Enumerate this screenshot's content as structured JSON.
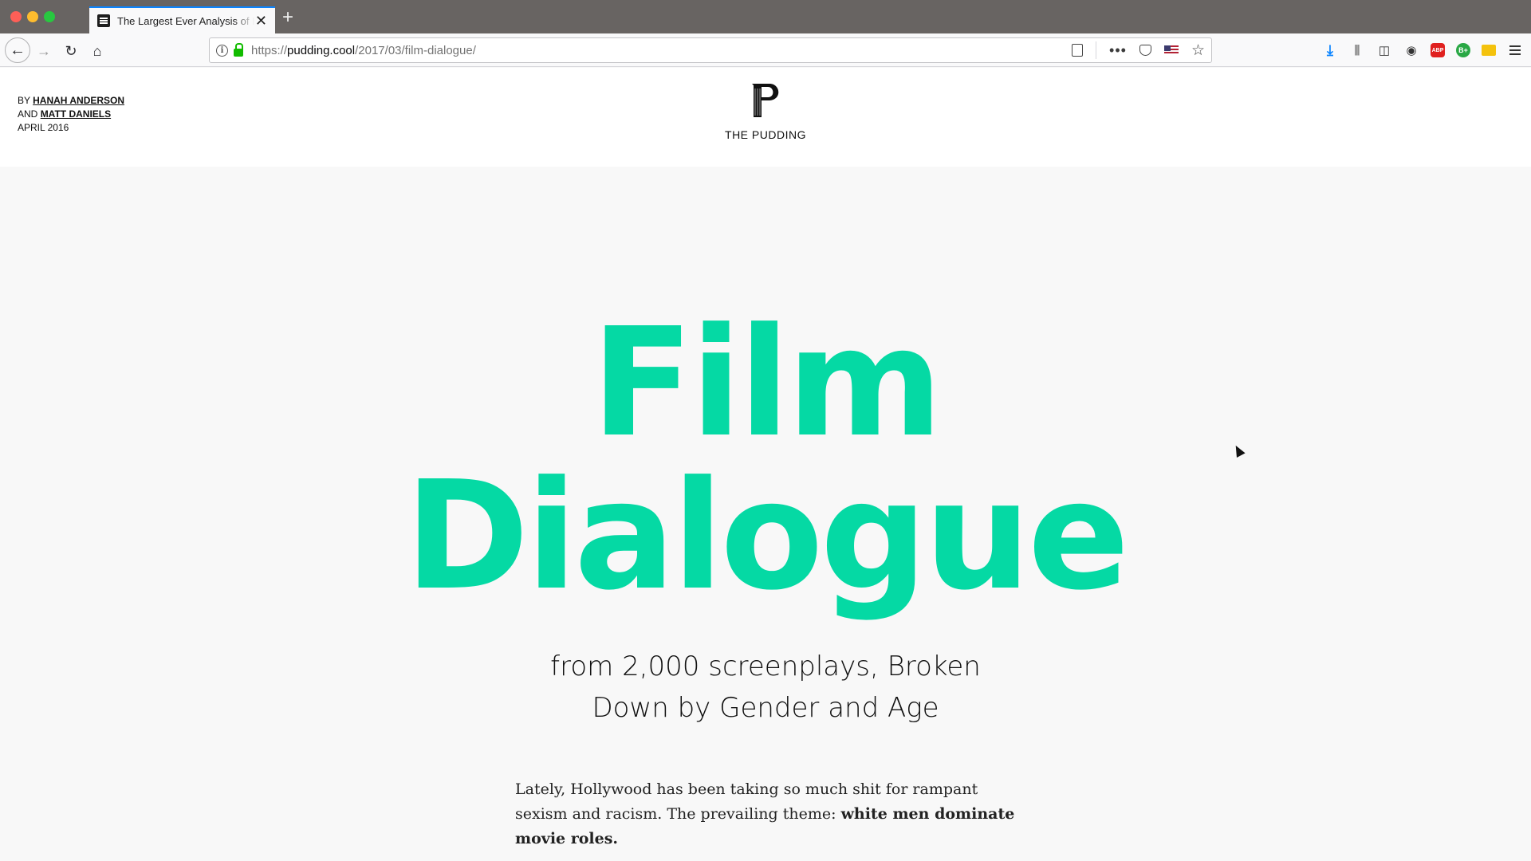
{
  "browser": {
    "tab_title": "The Largest Ever Analysis of Film Dialogue",
    "url_prefix": "https://",
    "url_host": "pudding.cool",
    "url_path": "/2017/03/film-dialogue/",
    "icons": [
      "back-icon",
      "forward-icon",
      "reload-icon",
      "home-icon",
      "info-icon",
      "lock-icon",
      "reader-view-icon",
      "page-actions-icon",
      "pocket-icon",
      "flag-icon",
      "bookmark-star-icon",
      "download-icon",
      "library-icon",
      "sidebar-icon",
      "account-icon",
      "adblock-icon",
      "green-extension-icon",
      "yellow-extension-icon",
      "menu-icon"
    ],
    "accent_color": "#0a84ff"
  },
  "header": {
    "by_label": "BY",
    "author1": "HANAH ANDERSON",
    "and_label": "AND",
    "author2": "MATT DANIELS",
    "date": "APRIL 2016",
    "logo_text": "THE PUDDING"
  },
  "hero": {
    "title_line1": "Film",
    "title_line2": "Dialogue",
    "subtitle_line1": "from 2,000 screenplays, Broken",
    "subtitle_line2": "Down by Gender and Age",
    "title_color": "#05d9a4"
  },
  "article": {
    "intro_text": "Lately, Hollywood has been taking so much shit for rampant sexism and racism. The prevailing theme: ",
    "intro_bold": "white men dominate movie roles."
  }
}
